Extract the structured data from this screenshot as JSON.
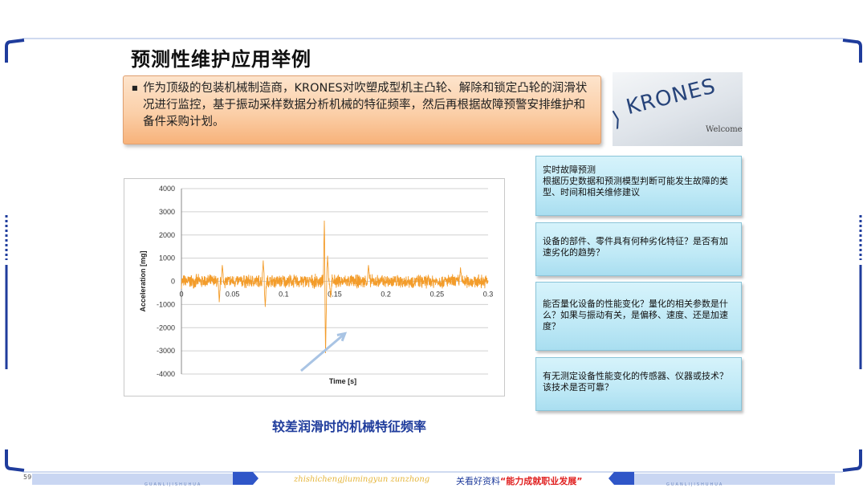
{
  "slide": {
    "title": "预测性维护应用举例",
    "bullet": "作为顶级的包装机械制造商，KRONES对吹塑成型机主凸轮、解除和锁定凸轮的润滑状况进行监控，基于振动采样数据分析机械的特征频率，然后再根据故障预警安排维护和备件采购计划。",
    "caption": "较差润滑时的机械特征频率",
    "questions": [
      "实时故障预测\n根据历史数据和预测模型判断可能发生故障的类型、时间和相关维修建议",
      "设备的部件、零件具有何种劣化特征？是否有加速劣化的趋势？",
      "能否量化设备的性能变化？量化的相关参数是什么？如果与振动有关，是偏移、速度、还是加速度？",
      "有无测定设备性能变化的传感器、仪器或技术？该技术是否可靠？"
    ]
  },
  "photo": {
    "logo_text": "KRONES",
    "welcome_text": "Welcome"
  },
  "footer": {
    "page_number": "59",
    "english": "zhishichengjiumingyun zunzhong",
    "promo": "关看好资料",
    "slogan": "“能力成就职业发展”",
    "sub_left": "GUANLIJISHUHUA",
    "sub_right": "GUANLIJISHUHUA"
  },
  "chart_data": {
    "type": "line",
    "xlabel": "Time [s]",
    "ylabel": "Acceleration [mg]",
    "xlim": [
      0,
      0.3
    ],
    "ylim": [
      -4000,
      4000
    ],
    "x_ticks": [
      0,
      0.05,
      0.1,
      0.15,
      0.2,
      0.25,
      0.3
    ],
    "x_tick_labels": [
      "0",
      "0.05",
      "0.1",
      "0.15",
      "0.2",
      "0.25",
      "0.3"
    ],
    "y_ticks": [
      4000,
      3000,
      2000,
      1000,
      0,
      -1000,
      -2000,
      -3000,
      -4000
    ],
    "y_tick_labels": [
      "4000",
      "3000",
      "2000",
      "1000",
      "0",
      "-1000",
      "-2000",
      "-3000",
      "-4000"
    ],
    "grid": true,
    "series": [
      {
        "color": "#f39c2a",
        "description": "vibration signal ~±300 mg with spike events",
        "baseline_amplitude": 300,
        "events": [
          {
            "x": 0.04,
            "y": 700
          },
          {
            "x": 0.037,
            "y": -900
          },
          {
            "x": 0.08,
            "y": 900
          },
          {
            "x": 0.082,
            "y": -1100
          },
          {
            "x": 0.14,
            "y": 3100
          },
          {
            "x": 0.141,
            "y": -3100
          },
          {
            "x": 0.143,
            "y": 1100
          },
          {
            "x": 0.146,
            "y": -700
          },
          {
            "x": 0.183,
            "y": 700
          },
          {
            "x": 0.273,
            "y": 600
          }
        ]
      }
    ],
    "annotation": {
      "type": "arrow",
      "from": [
        0.117,
        -4000
      ],
      "to": [
        0.16,
        -2250
      ],
      "color": "#a9c4e4"
    }
  }
}
